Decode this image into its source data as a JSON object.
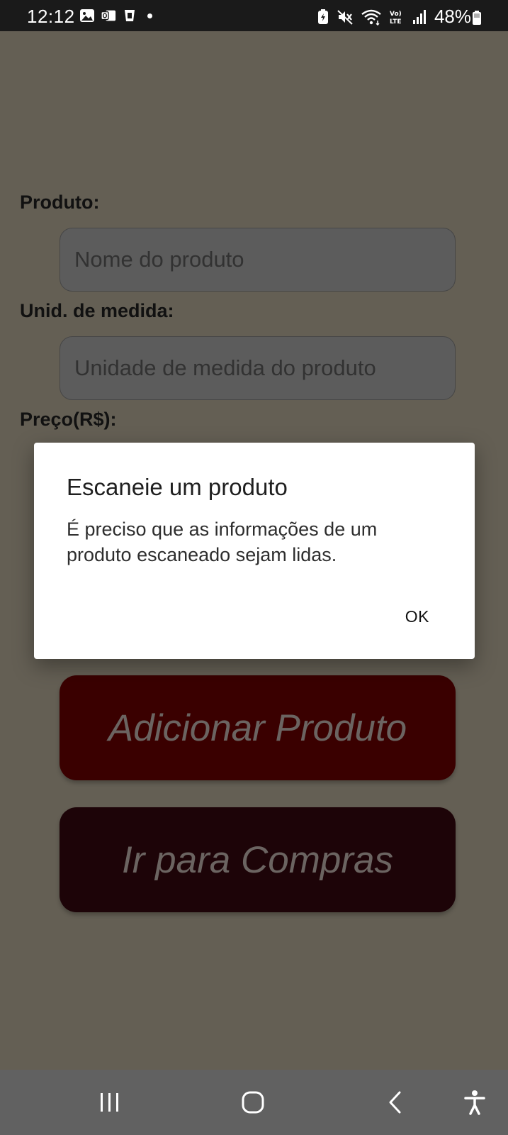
{
  "status_bar": {
    "time": "12:12",
    "battery": "48%",
    "icons": [
      "gallery-icon",
      "outlook-icon",
      "cup-icon",
      "notification-dot",
      "battery-saver-icon",
      "mute-icon",
      "wifi-icon",
      "volte-icon",
      "signal-icon",
      "battery-icon"
    ]
  },
  "form": {
    "product_label": "Produto:",
    "product_placeholder": "Nome do produto",
    "unit_label": "Unid. de medida:",
    "unit_placeholder": "Unidade de medida do produto",
    "price_label": "Preço(R$):"
  },
  "buttons": {
    "add_product": "Adicionar Produto",
    "go_to_purchases": "Ir para Compras"
  },
  "dialog": {
    "title": "Escaneie um produto",
    "message": "É preciso que as informações de um produto escaneado sejam lidas.",
    "ok_label": "OK"
  },
  "nav_bar": {
    "icons": [
      "recents-icon",
      "home-icon",
      "back-icon",
      "accessibility-icon"
    ]
  },
  "colors": {
    "scrim_background": "#645f54",
    "add_button": "#3a0000",
    "go_button": "#1d0408",
    "dialog_background": "#ffffff",
    "nav_bar": "#616161"
  }
}
